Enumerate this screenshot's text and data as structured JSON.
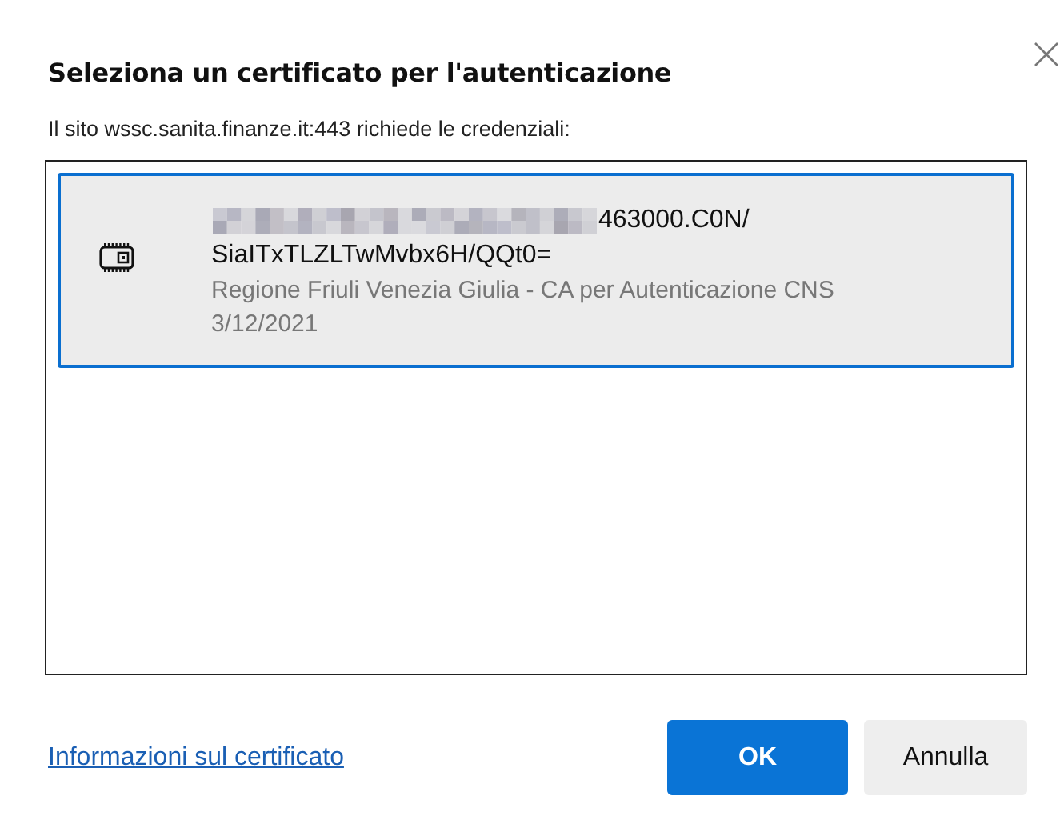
{
  "dialog": {
    "title": "Seleziona un certificato per l'autenticazione",
    "message": "Il sito wssc.sanita.finanze.it:443 richiede le credenziali:"
  },
  "certificates": [
    {
      "selected": true,
      "redacted": true,
      "subject": [
        "463000.C0N/",
        "SiaITxTLZLTwMvbx6H/QQt0="
      ],
      "issuer": "Regione Friuli Venezia Giulia - CA per Autenticazione CNS",
      "date": "3/12/2021"
    }
  ],
  "link": "Informazioni sul certificato",
  "buttons": [
    {
      "label": "OK",
      "kind": "primary"
    },
    {
      "label": "Annulla",
      "kind": "secondary"
    }
  ]
}
